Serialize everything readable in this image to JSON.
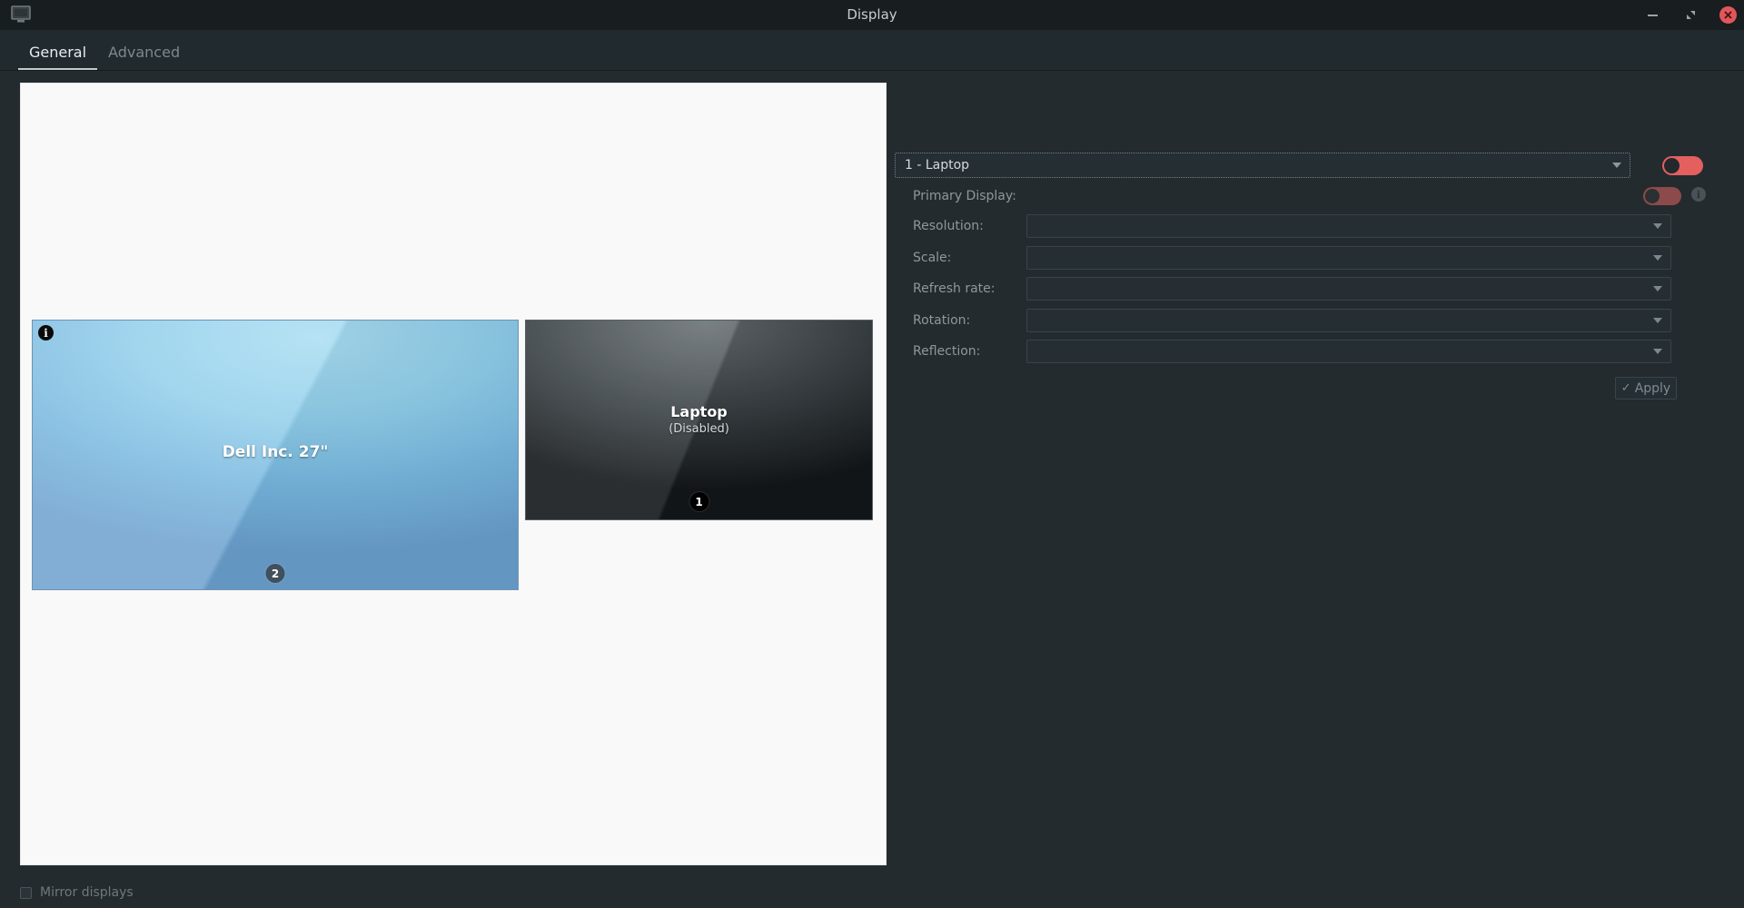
{
  "window": {
    "title": "Display",
    "icon": "monitor-icon",
    "minimize_label": "Minimize",
    "maximize_label": "Restore",
    "close_label": "Close"
  },
  "tabs": [
    {
      "label": "General",
      "active": true
    },
    {
      "label": "Advanced",
      "active": false
    }
  ],
  "preview": {
    "monitors": [
      {
        "id": 2,
        "name": "Dell Inc. 27\"",
        "badge": "2",
        "info_icon": "info-icon",
        "enabled": true
      },
      {
        "id": 1,
        "name": "Laptop",
        "status": "(Disabled)",
        "badge": "1",
        "enabled": false
      }
    ]
  },
  "mirror": {
    "label": "Mirror displays",
    "checked": false,
    "enabled": false
  },
  "panel": {
    "display_select": {
      "value": "1 - Laptop",
      "caret_icon": "chevron-down-icon"
    },
    "enable_toggle": {
      "on": true,
      "color": "#e3605f"
    },
    "primary": {
      "label": "Primary Display:",
      "on": false,
      "color": "#8d4a4b",
      "info_icon": "info-icon"
    },
    "fields": [
      {
        "key": "resolution",
        "label": "Resolution:",
        "value": ""
      },
      {
        "key": "scale",
        "label": "Scale:",
        "value": ""
      },
      {
        "key": "refresh",
        "label": "Refresh rate:",
        "value": ""
      },
      {
        "key": "rotation",
        "label": "Rotation:",
        "value": ""
      },
      {
        "key": "reflection",
        "label": "Reflection:",
        "value": ""
      }
    ],
    "apply": {
      "label": "Apply",
      "check_icon": "✓"
    }
  }
}
